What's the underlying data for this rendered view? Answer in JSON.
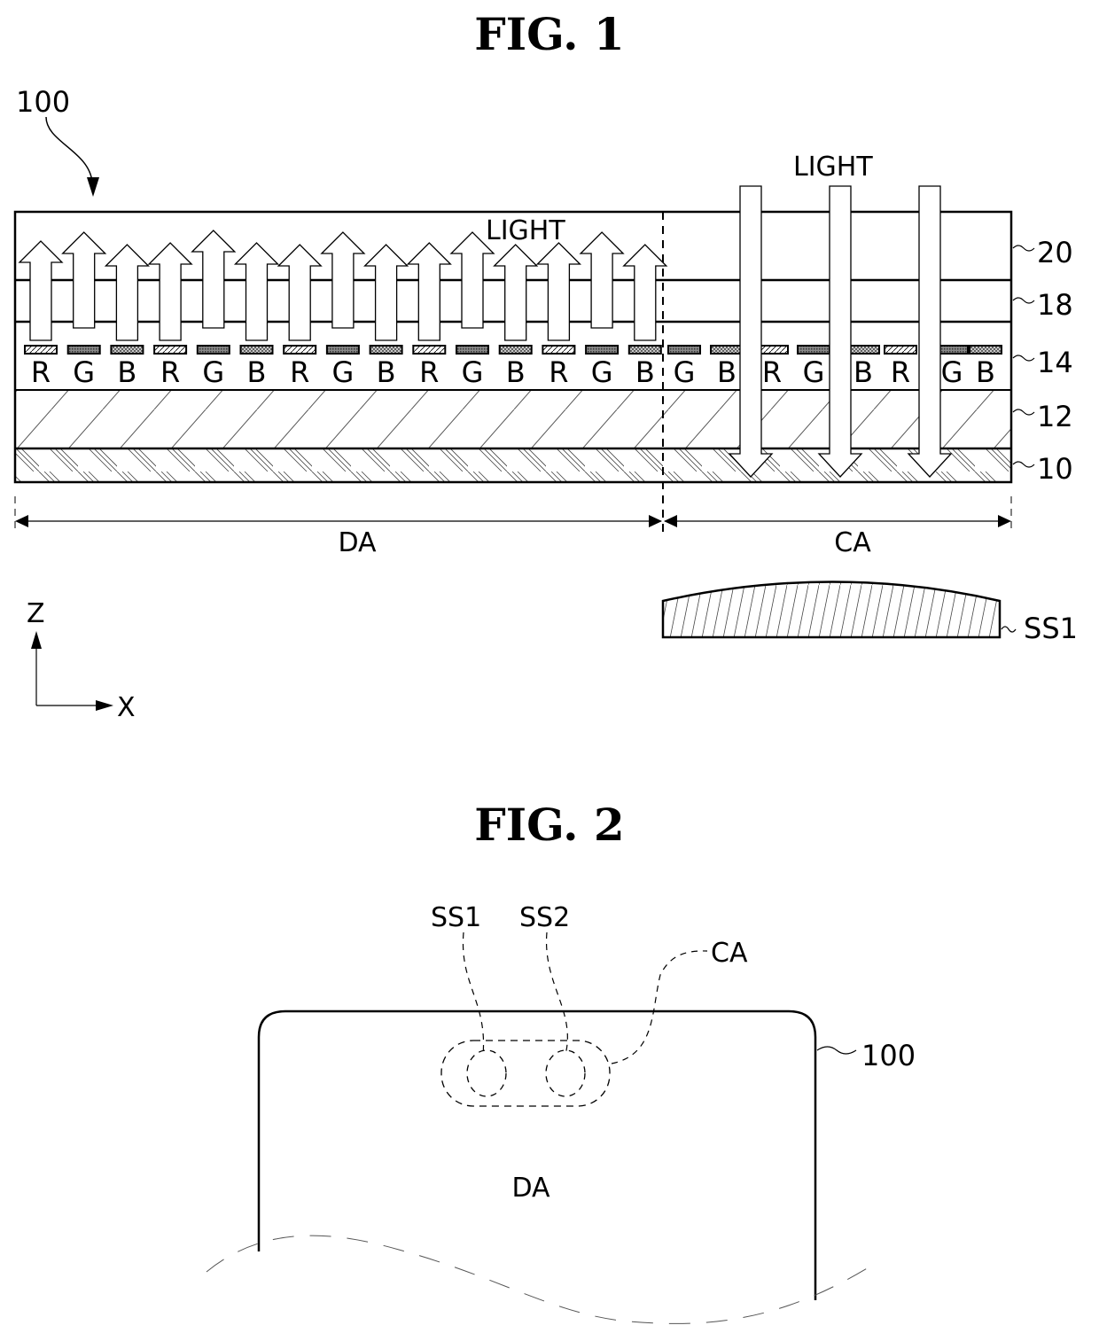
{
  "figure1": {
    "title": "FIG. 1",
    "device_ref": "100",
    "light_label_da": "LIGHT",
    "light_label_ca": "LIGHT",
    "layers": [
      {
        "ref": "20",
        "fill": "none"
      },
      {
        "ref": "18",
        "fill": "none"
      },
      {
        "ref": "14",
        "fill": "pixels"
      },
      {
        "ref": "12",
        "fill": "hatch-sparse"
      },
      {
        "ref": "10",
        "fill": "hatch-dense"
      }
    ],
    "da_pixels": [
      "R",
      "G",
      "B",
      "R",
      "G",
      "B",
      "R",
      "G",
      "B",
      "R",
      "G",
      "B",
      "R",
      "G",
      "B"
    ],
    "ca_pixels": [
      "G",
      "B",
      "R",
      "G",
      "B",
      "R",
      "G",
      "B"
    ],
    "region_labels": {
      "da": "DA",
      "ca": "CA"
    },
    "sensor_label": "SS1",
    "axis": {
      "z": "Z",
      "x": "X"
    }
  },
  "figure2": {
    "title": "FIG. 2",
    "sensor1": "SS1",
    "sensor2": "SS2",
    "camera_area": "CA",
    "device_ref": "100",
    "display_area": "DA"
  }
}
